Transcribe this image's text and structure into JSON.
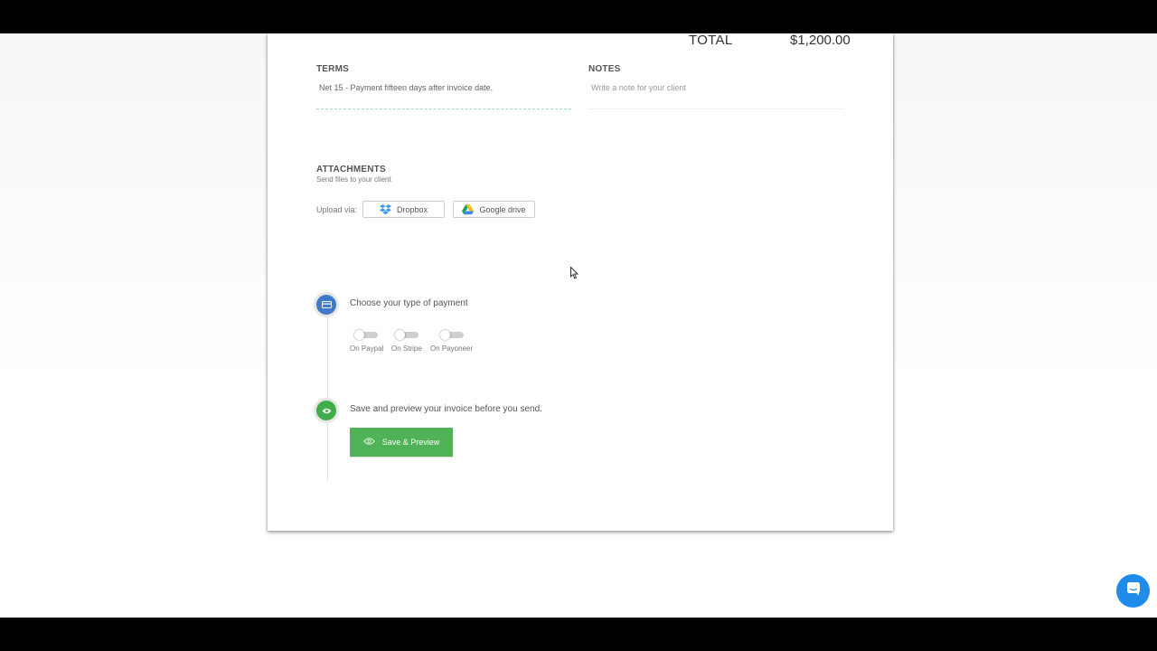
{
  "totals": {
    "label": "TOTAL",
    "value": "$1,200.00"
  },
  "terms": {
    "heading": "TERMS",
    "value": "Net 15 - Payment fifteen days after invoice date."
  },
  "notes": {
    "heading": "NOTES",
    "placeholder": "Write a note for your client"
  },
  "attachments": {
    "heading": "ATTACHMENTS",
    "subheading": "Send files to your client",
    "upload_label": "Upload via:",
    "dropbox_label": "Dropbox",
    "drive_label": "Google drive"
  },
  "payment": {
    "title": "Choose your type of payment",
    "options": [
      {
        "label": "On Paypal",
        "on": false
      },
      {
        "label": "On Stripe",
        "on": false
      },
      {
        "label": "On Payoneer",
        "on": false
      }
    ]
  },
  "preview": {
    "title": "Save and preview your invoice before you send.",
    "button_label": "Save & Preview"
  },
  "colors": {
    "step_blue": "#3e7ac7",
    "step_green": "#3fae49",
    "save_button": "#4fb257",
    "chat_bubble": "#1f8ceb"
  },
  "icons": [
    "dropbox-icon",
    "google-drive-icon",
    "card-icon",
    "eye-icon",
    "chat-icon",
    "mouse-cursor-icon"
  ]
}
